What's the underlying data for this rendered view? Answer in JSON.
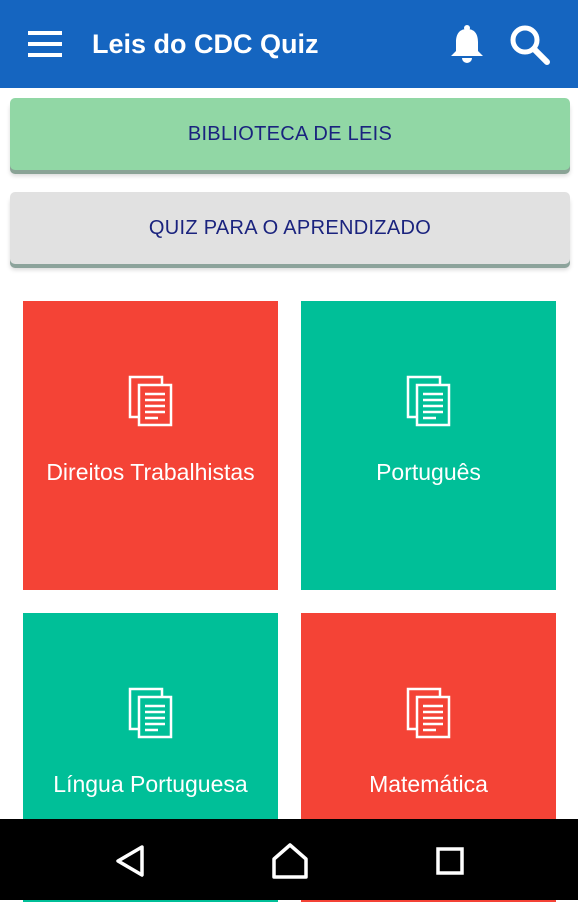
{
  "colors": {
    "appbar": "#1565c0",
    "library_button": "#91d7a5",
    "quiz_button": "#e1e1e1",
    "button_text": "#1a237e",
    "tile_red": "#f44336",
    "tile_green": "#00bf98",
    "navbar": "#000000"
  },
  "appbar": {
    "title": "Leis do CDC Quiz",
    "icons": [
      "menu-icon",
      "bell-icon",
      "search-icon"
    ]
  },
  "buttons": {
    "library": "BIBLIOTECA DE LEIS",
    "quiz": "QUIZ PARA O APRENDIZADO"
  },
  "tiles": [
    {
      "label": "Direitos Trabalhistas",
      "color": "#f44336",
      "icon": "document-icon"
    },
    {
      "label": "Português",
      "color": "#00bf98",
      "icon": "document-icon"
    },
    {
      "label": "Língua Portuguesa",
      "color": "#00bf98",
      "icon": "document-icon"
    },
    {
      "label": "Matemática",
      "color": "#f44336",
      "icon": "document-icon"
    }
  ],
  "navbar": {
    "icons": [
      "back-icon",
      "home-icon",
      "recents-icon"
    ]
  }
}
